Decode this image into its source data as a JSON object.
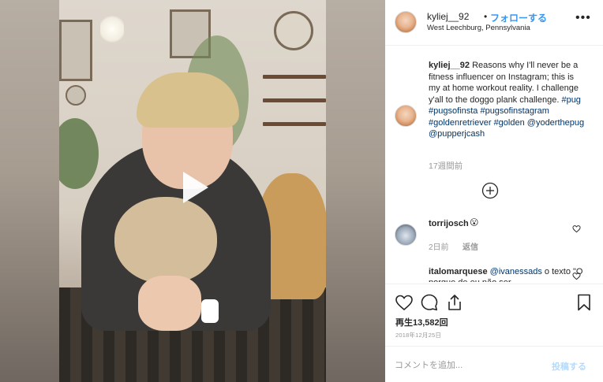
{
  "post": {
    "username": "kyliej__92",
    "dot": "•",
    "follow_label": "フォローする",
    "location": "West Leechburg, Pennsylvania",
    "more_label": "•••"
  },
  "caption": {
    "username": "kyliej__92",
    "text": "Reasons why I'll never be a fitness influencer on Instagram; this is my at home workout reality. I challenge y'all to the doggo plank challenge.",
    "tags": [
      "#pug",
      "#pugsofinsta",
      "#pugsofinstagram",
      "#goldenretriever",
      "#golden",
      "@yoderthepug",
      "@pupperjcash"
    ],
    "time_ago": "17週間前"
  },
  "comments": [
    {
      "username": "torrijosch",
      "emoji": "😮",
      "time": "2日前",
      "reply_label": "返信"
    },
    {
      "username": "italomarquese",
      "mention": "@ivanessads",
      "text": "o texto \"O porque de eu não ser"
    }
  ],
  "stats": {
    "views_label": "再生13,582回",
    "date": "2018年12月25日"
  },
  "comment_box": {
    "placeholder": "コメントを追加...",
    "post_label": "投稿する"
  },
  "icons": {
    "play": "play-icon",
    "load_more": "plus-circle-icon",
    "heart": "heart-icon",
    "comment": "comment-icon",
    "share": "share-icon",
    "save": "bookmark-icon",
    "more": "more-icon"
  },
  "colors": {
    "accent": "#3897f0",
    "hashtag": "#003569",
    "muted": "#999999",
    "post_disabled": "#b3dbff"
  }
}
